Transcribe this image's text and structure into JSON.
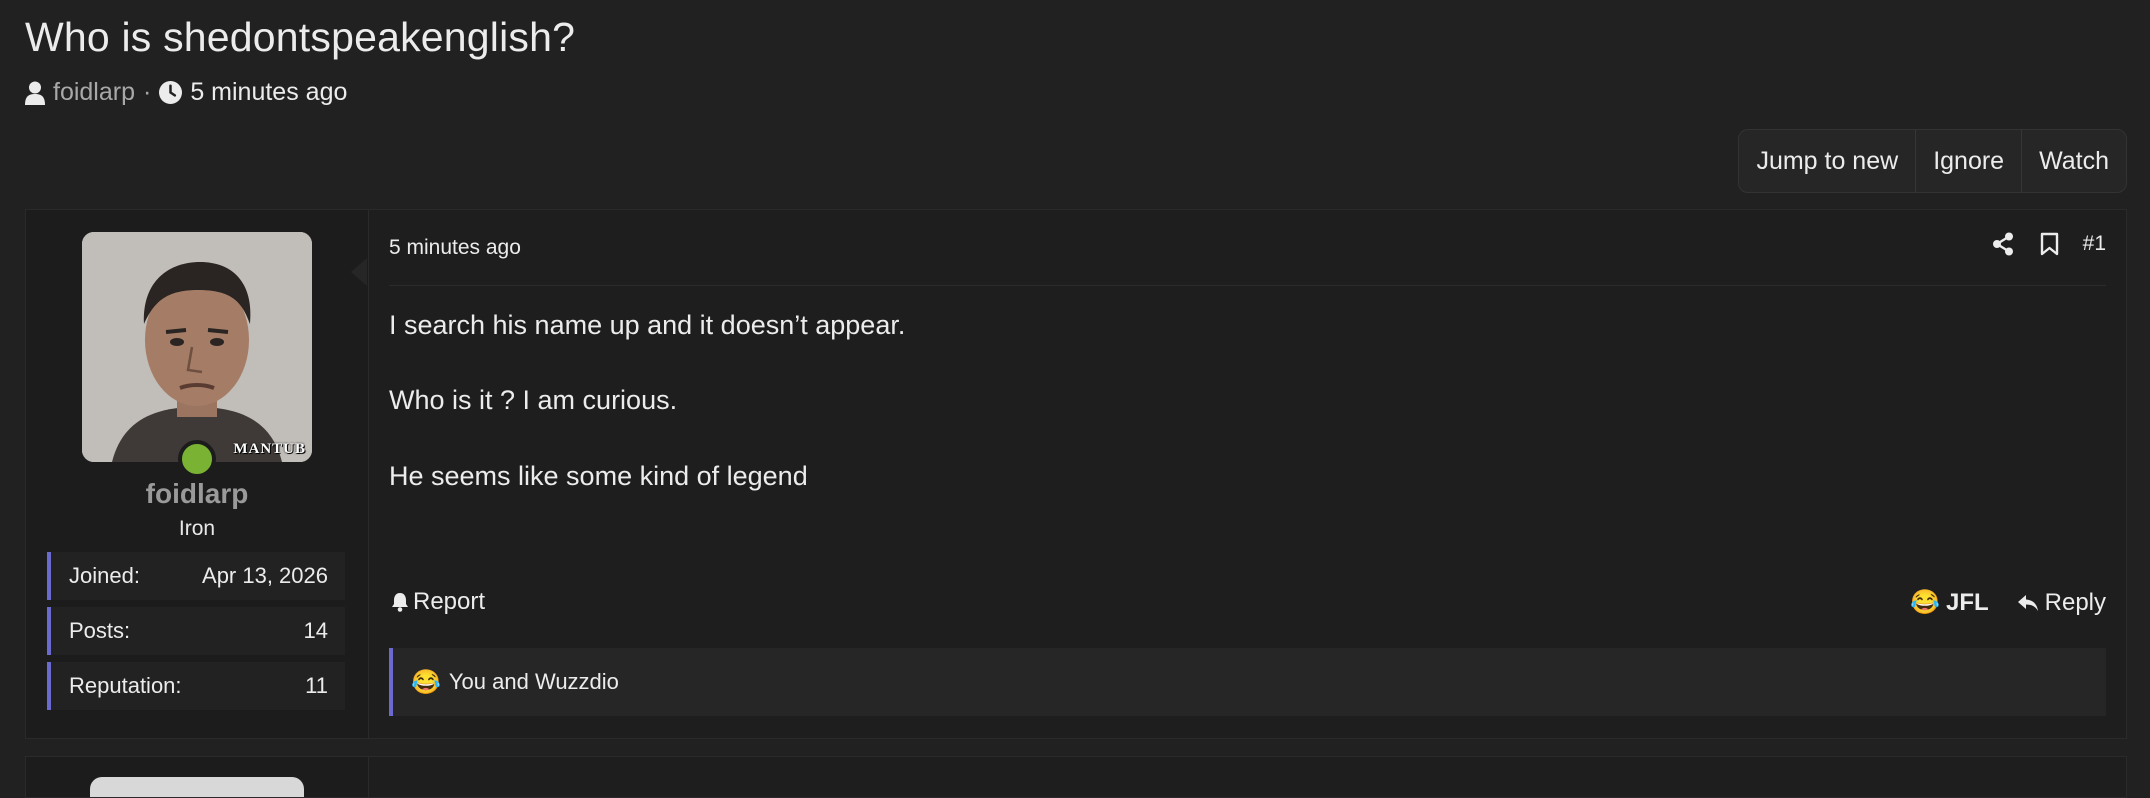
{
  "thread": {
    "title": "Who is shedontspeakenglish?",
    "author": "foidlarp",
    "separator": "·",
    "time": "5 minutes ago"
  },
  "actions": {
    "jump_to_new": "Jump to new",
    "ignore": "Ignore",
    "watch": "Watch"
  },
  "post": {
    "user": {
      "name": "foidlarp",
      "title": "Iron",
      "online": true,
      "avatar_watermark": "MANTUB",
      "stats": [
        {
          "label": "Joined:",
          "value": "Apr 13, 2026"
        },
        {
          "label": "Posts:",
          "value": "14"
        },
        {
          "label": "Reputation:",
          "value": "11"
        }
      ]
    },
    "date": "5 minutes ago",
    "number": "#1",
    "body": [
      "I search his name up and it doesn’t appear.",
      "Who is it ? I am curious.",
      "He seems like some kind of legend"
    ],
    "report_label": "Report",
    "reaction_emoji": "😂",
    "reaction_label": "JFL",
    "reply_label": "Reply",
    "reactions_summary": "You and Wuzzdio"
  },
  "icons": {
    "user": "user-icon",
    "clock": "clock-icon",
    "share": "share-icon",
    "bookmark": "bookmark-icon",
    "bell": "bell-icon",
    "reply": "reply-icon"
  },
  "colors": {
    "background": "#212121",
    "accent": "#6b6bcf",
    "online": "#7ab333"
  }
}
